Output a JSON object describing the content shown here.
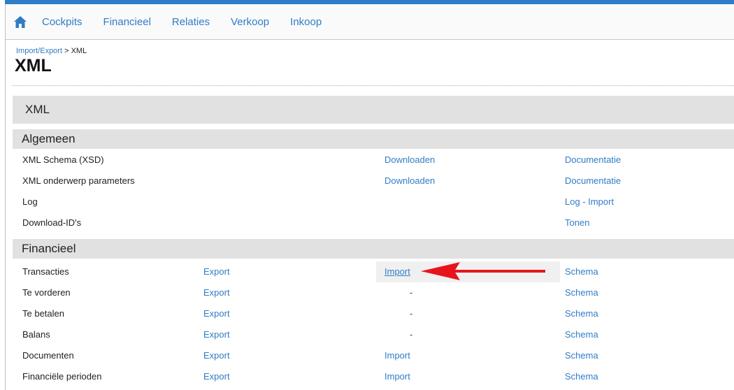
{
  "nav": {
    "home_icon": "home-icon",
    "items": [
      "Cockpits",
      "Financieel",
      "Relaties",
      "Verkoop",
      "Inkoop"
    ]
  },
  "breadcrumb": {
    "link": "Import/Export",
    "separator": " > ",
    "current": "XML"
  },
  "page_title": "XML",
  "panel_title": "XML",
  "sections": {
    "algemeen": {
      "title": "Algemeen",
      "rows": [
        {
          "label": "XML Schema (XSD)",
          "col3": "Downloaden",
          "col4": "Documentatie"
        },
        {
          "label": "XML onderwerp parameters",
          "col3": "Downloaden",
          "col4": "Documentatie"
        },
        {
          "label": "Log",
          "col3": "",
          "col4": "Log - Import"
        },
        {
          "label": "Download-ID's",
          "col3": "",
          "col4": "Tonen"
        }
      ]
    },
    "financieel": {
      "title": "Financieel",
      "rows": [
        {
          "label": "Transacties",
          "col2": "Export",
          "col3": "Import",
          "col4": "Schema"
        },
        {
          "label": "Te vorderen",
          "col2": "Export",
          "col3": "-",
          "col4": "Schema"
        },
        {
          "label": "Te betalen",
          "col2": "Export",
          "col3": "-",
          "col4": "Schema"
        },
        {
          "label": "Balans",
          "col2": "Export",
          "col3": "-",
          "col4": "Schema"
        },
        {
          "label": "Documenten",
          "col2": "Export",
          "col3": "Import",
          "col4": "Schema"
        },
        {
          "label": "Financiële perioden",
          "col2": "Export",
          "col3": "Import",
          "col4": "Schema"
        }
      ]
    }
  },
  "colors": {
    "accent": "#2f7dc6",
    "section_bg": "#e1e1e1",
    "annotation_arrow": "#e8141b"
  }
}
